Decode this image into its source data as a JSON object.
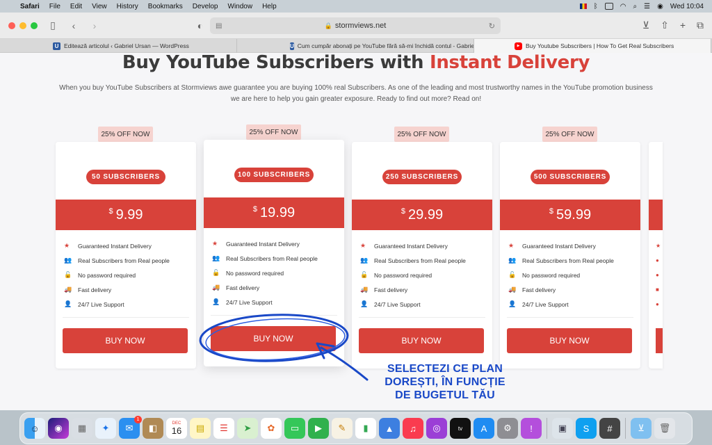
{
  "menubar": {
    "apple": "",
    "items": [
      "Safari",
      "File",
      "Edit",
      "View",
      "History",
      "Bookmarks",
      "Develop",
      "Window",
      "Help"
    ],
    "clock": "Wed 10:04"
  },
  "browser": {
    "url": "stormviews.net",
    "tabs": [
      {
        "label": "Editează articolul ‹ Gabriel Ursan — WordPress",
        "favicon": "U"
      },
      {
        "label": "Cum cumpăr abonați pe YouTube fără să-mi închidă contul - Gabriel Ursan",
        "favicon": "U"
      },
      {
        "label": "Buy Youtube Subscribers | How To Get Real Subscribers",
        "favicon": "▶"
      }
    ]
  },
  "page": {
    "headline_main": "Buy YouTube Subscribers with",
    "headline_accent": "Instant Delivery",
    "intro": "When you buy YouTube Subscribers at Stormviews awe guarantee you are buying 100% real Subscribers. As one of the leading and most trustworthy names in the YouTube promotion business we are here to help you gain greater exposure. Ready to find out more? Read on!",
    "plans": [
      {
        "badge": "25% OFF NOW",
        "name": "50 SUBSCRIBERS",
        "currency": "$",
        "price": "9.99",
        "buy": "BUY NOW"
      },
      {
        "badge": "25% OFF NOW",
        "name": "100 SUBSCRIBERS",
        "currency": "$",
        "price": "19.99",
        "buy": "BUY NOW"
      },
      {
        "badge": "25% OFF NOW",
        "name": "250 SUBSCRIBERS",
        "currency": "$",
        "price": "29.99",
        "buy": "BUY NOW"
      },
      {
        "badge": "25% OFF NOW",
        "name": "500 SUBSCRIBERS",
        "currency": "$",
        "price": "59.99",
        "buy": "BUY NOW"
      }
    ],
    "features": [
      {
        "icon": "star-icon",
        "glyph": "★",
        "label": "Guaranteed Instant Delivery"
      },
      {
        "icon": "users-icon",
        "glyph": "👥",
        "label": "Real Subscribers from Real people"
      },
      {
        "icon": "unlock-icon",
        "glyph": "🔓",
        "label": "No password required"
      },
      {
        "icon": "truck-icon",
        "glyph": "🚚",
        "label": "Fast delivery"
      },
      {
        "icon": "user-icon",
        "glyph": "👤",
        "label": "24/7 Live Support"
      }
    ]
  },
  "annotation": {
    "line1": "SELECTEZI CE PLAN",
    "line2": "DOREȘTI, ÎN FUNCȚIE",
    "line3": "DE BUGETUL TĂU",
    "color": "#1948c7"
  },
  "dock": {
    "calendar_month": "DEC",
    "calendar_day": "16",
    "mail_badge": "1"
  },
  "colors": {
    "accent": "#d8423a",
    "badge_bg": "#f6d3cf"
  }
}
